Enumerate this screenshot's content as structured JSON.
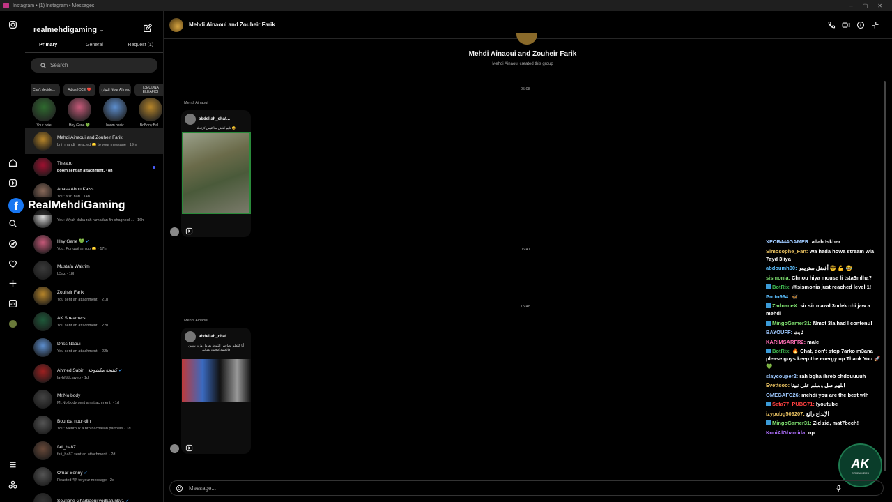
{
  "window": {
    "title": "Instagram • (1) Instagram • Messages",
    "controls": [
      "–",
      "▢",
      "✕"
    ]
  },
  "rail": {
    "items": [
      "instagram-logo-icon",
      "home-icon",
      "reels-icon",
      "explore-icon",
      "search-icon",
      "compass-icon",
      "heart-icon",
      "create-icon",
      "dashboard-icon",
      "profile-icon",
      "menu-icon",
      "meta-icon"
    ]
  },
  "inbox": {
    "username": "realmehdigaming",
    "tabs": [
      {
        "label": "Primary"
      },
      {
        "label": "General"
      },
      {
        "label": "Request (1)"
      }
    ],
    "search_placeholder": "Search",
    "notes": [
      {
        "bubble": "Can't decide...",
        "name": "Your note",
        "color": "#2f6b2f"
      },
      {
        "bubble": "Adios ICCE ❤️",
        "name": "Hey Gene 💚",
        "color": "#c85a7a"
      },
      {
        "bubble": "التوازن Nour Ahmed",
        "name": "boom basic",
        "color": "#5d8fd0"
      },
      {
        "bubble": "T3EQDNA ELHAFIDI",
        "name": "BoBony Bal...",
        "color": "#b8862a"
      }
    ],
    "threads": [
      {
        "name": "Mehdi Ainaoui and Zouheir Farik",
        "sub": "bnj_mahdi_ reacted 😊 to your message · 19m",
        "bold": false,
        "color": "#b8862a"
      },
      {
        "name": "Theatro",
        "sub": "boom sent an attachment. · 8h",
        "bold": true,
        "color": "#a01030",
        "unread": true
      },
      {
        "name": "Anass Abou Kaiss",
        "sub": "You: Nzri nari · 14h",
        "bold": false,
        "color": "#8a6a5a"
      },
      {
        "name": "",
        "sub": "You: Wyah daba rah ramadan fin chaghoul ... · 16h",
        "bold": false,
        "color": "#dddddd"
      },
      {
        "name": "Hey Gene 💚",
        "sub": "You: Por qué amigo 😊 · 17h",
        "bold": false,
        "color": "#c85a7a",
        "verified": true
      },
      {
        "name": "Mustafa Wakrim",
        "sub": "L3az · 18h",
        "bold": false,
        "color": "#3a3a3a"
      },
      {
        "name": "Zouheir Farik",
        "sub": "You sent an attachment. · 21h",
        "bold": false,
        "color": "#b8862a"
      },
      {
        "name": "AK Streamers",
        "sub": "You sent an attachment. · 22h",
        "bold": false,
        "color": "#1e5a3a"
      },
      {
        "name": "Driss Naoui",
        "sub": "You sent an attachment. · 22h",
        "bold": false,
        "color": "#5d8fd0"
      },
      {
        "name": "Ahmed Sabiri | كشخة مكشوخة",
        "sub": "layhfddc aveo · 1d",
        "bold": false,
        "color": "#a02020",
        "verified": true
      },
      {
        "name": "Mr.No.body",
        "sub": "Mr.No.body sent an attachment. · 1d",
        "bold": false,
        "color": "#444444"
      },
      {
        "name": "Bounba nour-din",
        "sub": "You: Mebrouk a bro nachallah partners · 1d",
        "bold": false,
        "color": "#555555"
      },
      {
        "name": "fati_ha87",
        "sub": "fati_ha87 sent an attachment. · 2d",
        "bold": false,
        "color": "#6a4a3a"
      },
      {
        "name": "Omar Benny",
        "sub": "Reacted 🖤 to your message · 2d",
        "bold": false,
        "color": "#555555",
        "verified": true
      },
      {
        "name": "Soufiane Gharbaoui vodkafunky1",
        "sub": "",
        "bold": false,
        "color": "#333333",
        "verified": true
      }
    ]
  },
  "overlay": {
    "fb_letter": "f",
    "name": "RealMehdiGaming"
  },
  "chat": {
    "title": "Mehdi Ainaoui and Zouheir Farik",
    "intro_name": "Mehdi Ainaoui and Zouheir Farik",
    "intro_sub": "Mehdi Ainaoui created this group",
    "timestamps": [
      "05:08",
      "06:41",
      "15:48"
    ],
    "posts": [
      {
        "sender": "Mehdi Ainaoui",
        "user": "abdellah_chaf...",
        "caption": "نايم كناش ساكتيس كرتحلة 😄"
      },
      {
        "sender": "Mehdi Ainaoui",
        "user": "abdellah_chaf...",
        "caption": "أنا كنتعلم لصاحبي النتيجة بعدما دوزت يومين فالكتيبة كيجيت عمالي"
      }
    ],
    "message_placeholder": "Message..."
  },
  "stream_chat": {
    "lines": [
      {
        "user": "XFOR444GAMER:",
        "text": "allah Iskher",
        "color": "#9ec9ff"
      },
      {
        "user": "Simosophe_Fan:",
        "text": "Wa hada howa stream wla 7ayd 3liya",
        "color": "#e8c060"
      },
      {
        "user": "abdoumh00:",
        "text": "أفضل ستريمر 😎 💪 😂",
        "color": "#5cc0ff"
      },
      {
        "user": "sismonia:",
        "text": "Chnou hiya mouse li tsta3mlha?",
        "color": "#7fe070"
      },
      {
        "user": "BotRix:",
        "text": "@sismonia just reached level 1!",
        "color": "#3fb950",
        "badge": true
      },
      {
        "user": "Proto994:",
        "text": "🦋",
        "color": "#5cc0ff"
      },
      {
        "user": "ZadnaneX:",
        "text": "sir sir mazal 3ndek chi jaw a mehdi",
        "color": "#7fe070",
        "badge": true
      },
      {
        "user": "MingoGamer31:",
        "text": "Nmot 3la had l contenu!",
        "color": "#7fe070",
        "badge": true
      },
      {
        "user": "BAYOUFF:",
        "text": "ثابت",
        "color": "#9ec9ff"
      },
      {
        "user": "KARIMSARFR2:",
        "text": "male",
        "color": "#ff6fb5"
      },
      {
        "user": "BotRix:",
        "text": "🔥 Chat, don't stop 7arko m3ana please guys keep the energy up Thank You 🚀 💚",
        "color": "#3fb950",
        "badge": true
      },
      {
        "user": "slaycouper2:",
        "text": "rah bgha ihreb chdouuuuh",
        "color": "#9ec9ff"
      },
      {
        "user": "Evettcoo:",
        "text": "اللهم صل وسلم على نبينا",
        "color": "#e8c060"
      },
      {
        "user": "OMEGAFC26:",
        "text": "mehdi you are the best wlh",
        "color": "#9ec9ff"
      },
      {
        "user": "Sefa77_PUBG71:",
        "text": "lyoutube",
        "color": "#ff4040",
        "badge": true
      },
      {
        "user": "izypubg509207:",
        "text": "الإبداع رائع",
        "color": "#e8c060"
      },
      {
        "user": "MingoGamer31:",
        "text": "Zid zid, mat7bech!",
        "color": "#7fe070",
        "badge": true
      },
      {
        "user": "KoniAlGhamida:",
        "text": "np",
        "color": "#b070ff"
      }
    ]
  },
  "ak_logo": {
    "title": "AK",
    "subtitle": "STREAMERS"
  }
}
